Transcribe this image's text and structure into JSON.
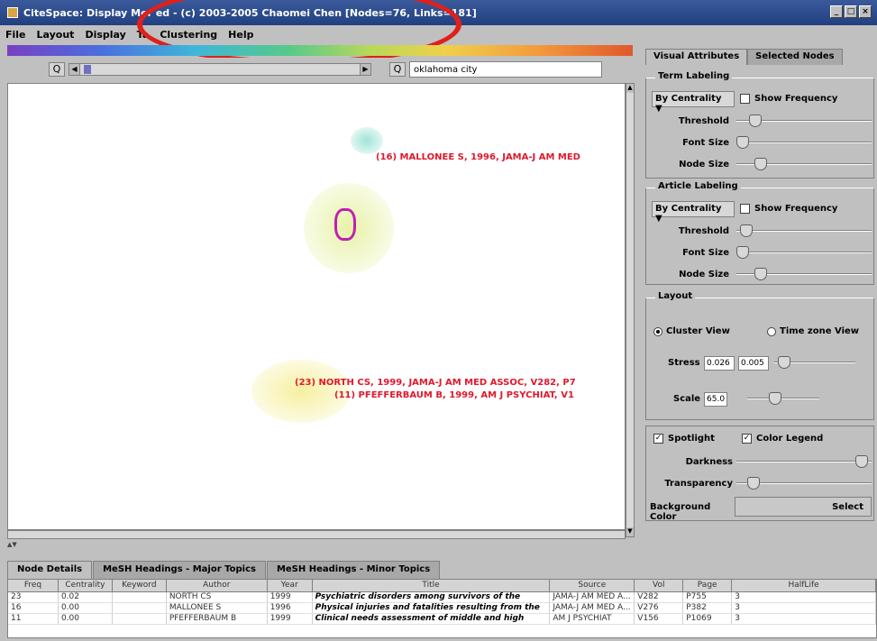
{
  "window": {
    "title": "CiteSpace: Display Merged - (c) 2003-2005 Chaomei Chen [Nodes=76, Links=181]",
    "title_visible": "CiteSpace: Display Mer     ed - (c) 2003-2005 Chaomei Chen [Nodes=76, Links=181]"
  },
  "menu": [
    "File",
    "Layout",
    "Display",
    "Ta",
    "Clustering",
    "Help"
  ],
  "toolbar": {
    "search_value": "oklahoma city",
    "zoom_out": "Q",
    "zoom_in": "Q"
  },
  "canvas": {
    "labels": [
      "(16) MALLONEE S, 1996, JAMA-J AM MED",
      "(23) NORTH CS, 1999, JAMA-J AM MED ASSOC, V282, P7",
      "(11) PFEFFERBAUM B, 1999, AM J PSYCHIAT, V1"
    ],
    "highlight_color": "#e0201a"
  },
  "panel": {
    "tabs": [
      "Visual Attributes",
      "Selected Nodes"
    ],
    "term_labeling": {
      "title": "Term Labeling",
      "combo": "By Centrality",
      "show_frequency": "Show Frequency",
      "threshold": "Threshold",
      "font_size": "Font Size",
      "node_size": "Node Size"
    },
    "article_labeling": {
      "title": "Article Labeling",
      "combo": "By Centrality",
      "show_frequency": "Show Frequency",
      "threshold": "Threshold",
      "font_size": "Font Size",
      "node_size": "Node Size"
    },
    "layout": {
      "title": "Layout",
      "cluster_view": "Cluster View",
      "time_zone_view": "Time zone View",
      "stress_label": "Stress",
      "stress_a": "0.026",
      "stress_b": "0.005",
      "scale_label": "Scale",
      "scale_value": "65.0"
    },
    "spotlight": {
      "spotlight": "Spotlight",
      "color_legend": "Color Legend",
      "darkness": "Darkness",
      "transparency": "Transparency",
      "background_color": "Background Color",
      "select": "Select"
    }
  },
  "bottom_tabs": [
    "Node Details",
    "MeSH Headings - Major Topics",
    "MeSH Headings - Minor Topics"
  ],
  "table": {
    "headers": [
      "Freq",
      "Centrality",
      "Keyword",
      "Author",
      "Year",
      "Title",
      "Source",
      "Vol",
      "Page",
      "HalfLife"
    ],
    "rows": [
      [
        "23",
        "0.02",
        "",
        "NORTH CS",
        "1999",
        "Psychiatric disorders among survivors of the",
        "JAMA-J AM MED A...",
        "V282",
        "P755",
        "3"
      ],
      [
        "16",
        "0.00",
        "",
        "MALLONEE S",
        "1996",
        "Physical injuries and fatalities resulting from the",
        "JAMA-J AM MED A...",
        "V276",
        "P382",
        "3"
      ],
      [
        "11",
        "0.00",
        "",
        "PFEFFERBAUM B",
        "1999",
        "Clinical needs assessment of middle and high",
        "AM J PSYCHIAT",
        "V156",
        "P1069",
        "3"
      ]
    ]
  }
}
